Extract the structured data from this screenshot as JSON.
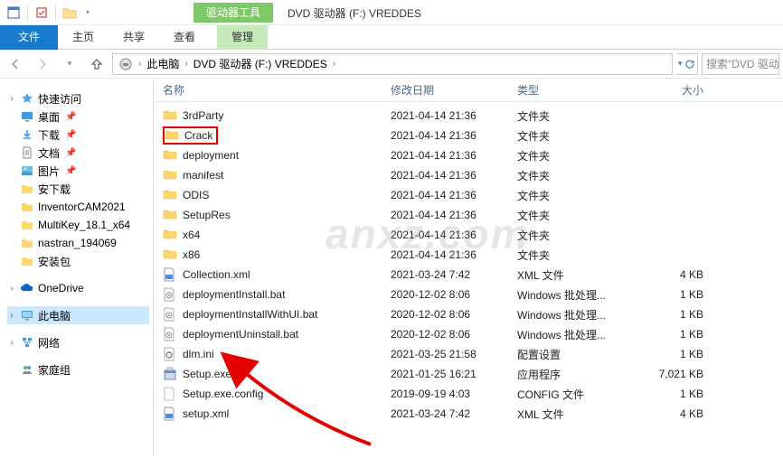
{
  "title": {
    "ribbon_context_label": "驱动器工具",
    "window_title": "DVD 驱动器 (F:) VREDDES"
  },
  "ribbon": {
    "file": "文件",
    "home": "主页",
    "share": "共享",
    "view": "查看",
    "manage": "管理"
  },
  "breadcrumbs": {
    "this_pc": "此电脑",
    "drive": "DVD 驱动器 (F:) VREDDES"
  },
  "search_placeholder": "搜索\"DVD 驱动...",
  "columns": {
    "name": "名称",
    "date": "修改日期",
    "type": "类型",
    "size": "大小"
  },
  "sidebar": {
    "quick_access": "快速访问",
    "desktop": "桌面",
    "downloads": "下载",
    "documents": "文档",
    "pictures": "图片",
    "anxia": "安下载",
    "inventorcam": "InventorCAM2021",
    "multikey": "MultiKey_18.1_x64",
    "nastran": "nastran_194069",
    "anzhuang": "安装包",
    "onedrive": "OneDrive",
    "this_pc": "此电脑",
    "network": "网络",
    "homegroup": "家庭组"
  },
  "files": [
    {
      "icon": "folder",
      "name": "3rdParty",
      "date": "2021-04-14 21:36",
      "type": "文件夹",
      "size": ""
    },
    {
      "icon": "folder",
      "name": "Crack",
      "date": "2021-04-14 21:36",
      "type": "文件夹",
      "size": "",
      "highlight": true
    },
    {
      "icon": "folder",
      "name": "deployment",
      "date": "2021-04-14 21:36",
      "type": "文件夹",
      "size": ""
    },
    {
      "icon": "folder",
      "name": "manifest",
      "date": "2021-04-14 21:36",
      "type": "文件夹",
      "size": ""
    },
    {
      "icon": "folder",
      "name": "ODIS",
      "date": "2021-04-14 21:36",
      "type": "文件夹",
      "size": ""
    },
    {
      "icon": "folder",
      "name": "SetupRes",
      "date": "2021-04-14 21:36",
      "type": "文件夹",
      "size": ""
    },
    {
      "icon": "folder",
      "name": "x64",
      "date": "2021-04-14 21:36",
      "type": "文件夹",
      "size": ""
    },
    {
      "icon": "folder",
      "name": "x86",
      "date": "2021-04-14 21:36",
      "type": "文件夹",
      "size": ""
    },
    {
      "icon": "xml",
      "name": "Collection.xml",
      "date": "2021-03-24 7:42",
      "type": "XML 文件",
      "size": "4 KB"
    },
    {
      "icon": "bat",
      "name": "deploymentInstall.bat",
      "date": "2020-12-02 8:06",
      "type": "Windows 批处理...",
      "size": "1 KB"
    },
    {
      "icon": "bat",
      "name": "deploymentInstallWithUI.bat",
      "date": "2020-12-02 8:06",
      "type": "Windows 批处理...",
      "size": "1 KB"
    },
    {
      "icon": "bat",
      "name": "deploymentUninstall.bat",
      "date": "2020-12-02 8:06",
      "type": "Windows 批处理...",
      "size": "1 KB"
    },
    {
      "icon": "ini",
      "name": "dlm.ini",
      "date": "2021-03-25 21:58",
      "type": "配置设置",
      "size": "1 KB"
    },
    {
      "icon": "exe",
      "name": "Setup.exe",
      "date": "2021-01-25 16:21",
      "type": "应用程序",
      "size": "7,021 KB"
    },
    {
      "icon": "config",
      "name": "Setup.exe.config",
      "date": "2019-09-19 4:03",
      "type": "CONFIG 文件",
      "size": "1 KB"
    },
    {
      "icon": "xml",
      "name": "setup.xml",
      "date": "2021-03-24 7:42",
      "type": "XML 文件",
      "size": "4 KB"
    }
  ]
}
